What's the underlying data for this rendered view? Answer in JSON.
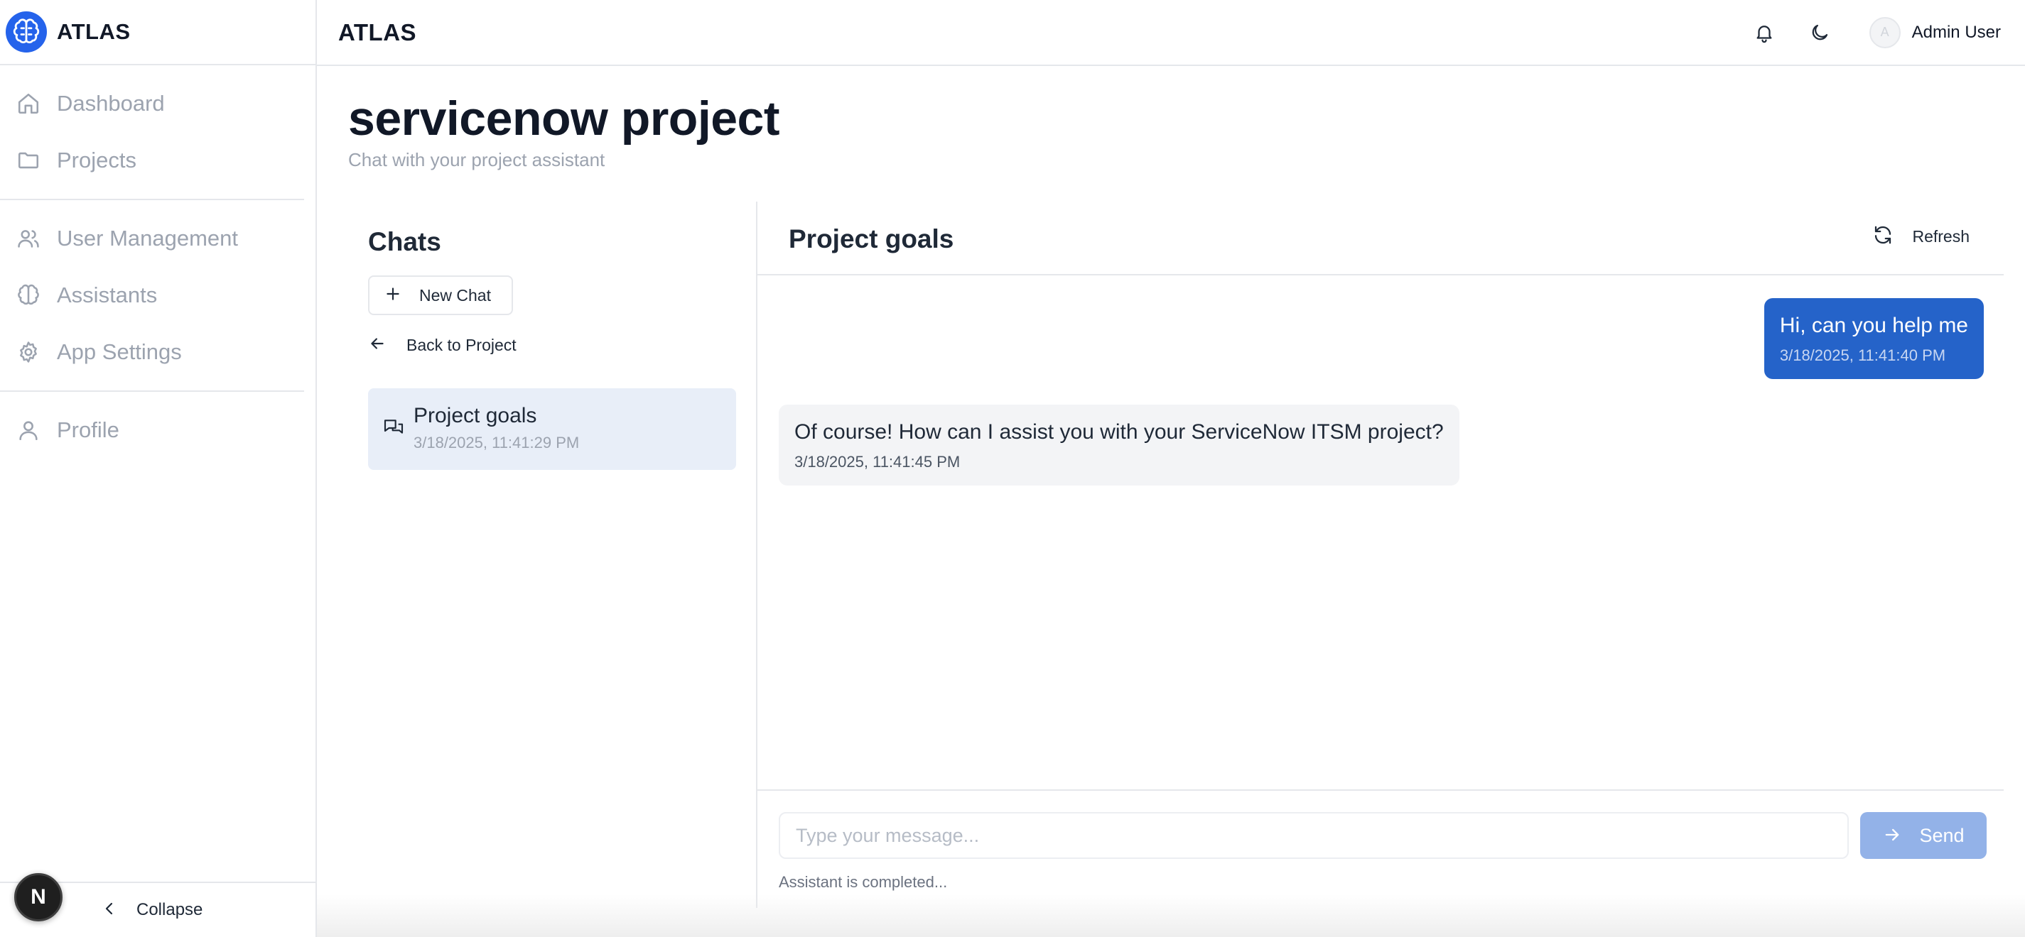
{
  "app": {
    "name": "ATLAS"
  },
  "sidebar": {
    "items": [
      {
        "label": "Dashboard",
        "icon": "home-icon"
      },
      {
        "label": "Projects",
        "icon": "folder-icon"
      },
      {
        "label": "User Management",
        "icon": "users-icon"
      },
      {
        "label": "Assistants",
        "icon": "brain-icon"
      },
      {
        "label": "App Settings",
        "icon": "gear-icon"
      },
      {
        "label": "Profile",
        "icon": "user-icon"
      }
    ],
    "collapse_label": "Collapse",
    "dev_badge": "N"
  },
  "topbar": {
    "title": "ATLAS",
    "user_initial": "A",
    "user_name": "Admin User"
  },
  "page": {
    "title": "servicenow project",
    "subtitle": "Chat with your project assistant"
  },
  "chats": {
    "heading": "Chats",
    "new_chat_label": "New Chat",
    "back_label": "Back to Project",
    "items": [
      {
        "title": "Project goals",
        "time": "3/18/2025, 11:41:29 PM",
        "selected": true
      }
    ]
  },
  "conversation": {
    "title": "Project goals",
    "refresh_label": "Refresh",
    "messages": [
      {
        "role": "user",
        "text": "Hi, can you help me",
        "time": "3/18/2025, 11:41:40 PM"
      },
      {
        "role": "assistant",
        "text": "Of course! How can I assist you with your ServiceNow ITSM project?",
        "time": "3/18/2025, 11:41:45 PM"
      }
    ],
    "input_placeholder": "Type your message...",
    "send_label": "Send",
    "status": "Assistant is completed..."
  },
  "colors": {
    "accent": "#2563eb",
    "user_bubble": "#2563c9",
    "selected_chat": "#e8eef8",
    "send_disabled": "#93b2e8"
  }
}
